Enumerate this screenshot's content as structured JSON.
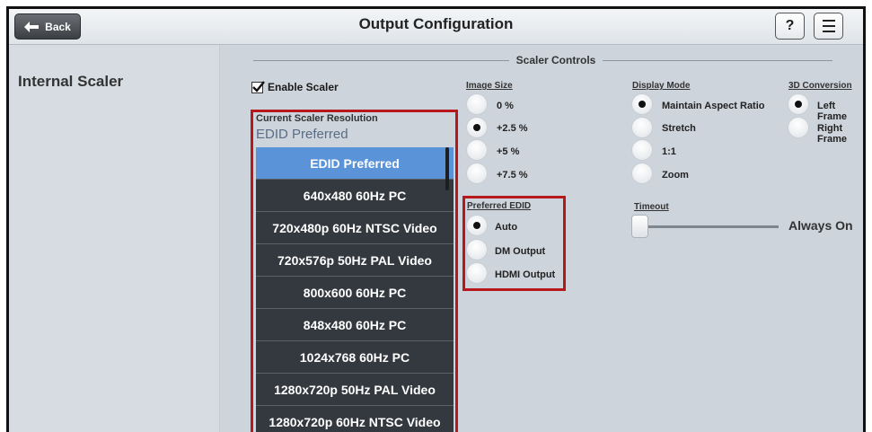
{
  "header": {
    "back_label": "Back",
    "title": "Output Configuration",
    "help_label": "?"
  },
  "sidebar": {
    "title": "Internal Scaler"
  },
  "section": {
    "title": "Scaler Controls"
  },
  "enable_scaler": {
    "label": "Enable Scaler",
    "checked": true
  },
  "resolution": {
    "label": "Current Scaler Resolution",
    "value": "EDID Preferred",
    "items": [
      "EDID Preferred",
      "640x480 60Hz PC",
      "720x480p 60Hz NTSC Video",
      "720x576p 50Hz PAL Video",
      "800x600 60Hz PC",
      "848x480 60Hz PC",
      "1024x768 60Hz PC",
      "1280x720p 50Hz PAL Video",
      "1280x720p 60Hz NTSC Video"
    ],
    "selected_index": 0
  },
  "image_size": {
    "label": "Image Size",
    "options": [
      "0 %",
      "+2.5 %",
      "+5 %",
      "+7.5 %"
    ],
    "selected": "+2.5 %"
  },
  "preferred_edid": {
    "label": "Preferred EDID",
    "options": [
      "Auto",
      "DM Output",
      "HDMI Output"
    ],
    "selected": "Auto"
  },
  "display_mode": {
    "label": "Display Mode",
    "options": [
      "Maintain Aspect Ratio",
      "Stretch",
      "1:1",
      "Zoom"
    ],
    "selected": "Maintain Aspect Ratio"
  },
  "conversion_3d": {
    "label": "3D Conversion",
    "options": [
      "Left Frame",
      "Right Frame"
    ],
    "selected": "Left Frame"
  },
  "timeout": {
    "label": "Timeout",
    "value": "Always On",
    "level": 0
  },
  "colors": {
    "highlight_border": "#b7181c",
    "selected_item": "#5b93d8",
    "list_item": "#34393f"
  }
}
